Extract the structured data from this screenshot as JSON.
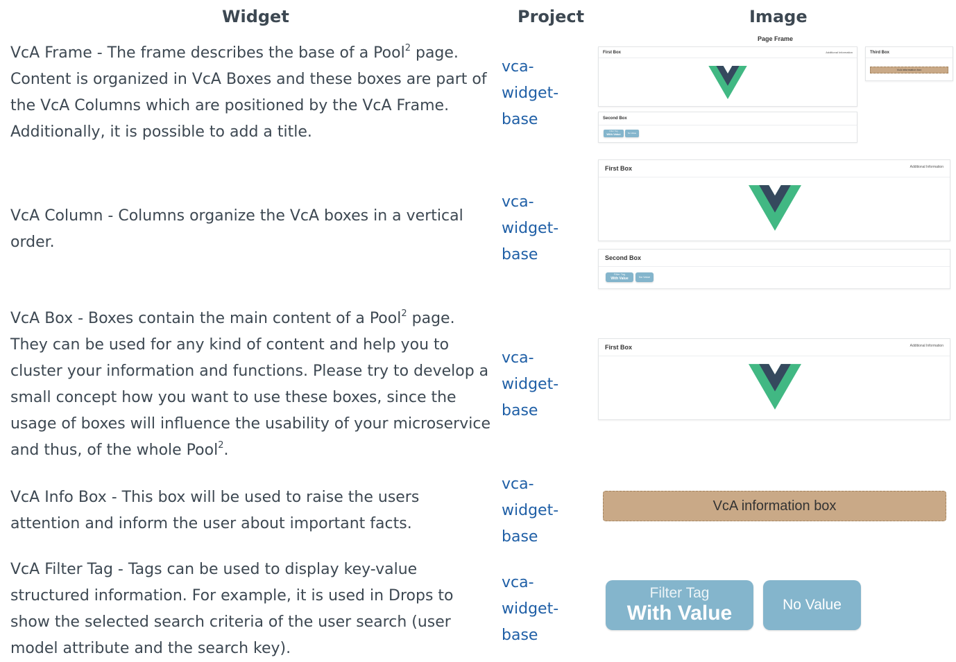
{
  "headers": {
    "widget": "Widget",
    "project": "Project",
    "image": "Image"
  },
  "rows": [
    {
      "widget_text": "VcA Frame - The frame describes the base of a Pool",
      "sup1": "2",
      "widget_text_b": " page. Content is organized in VcA Boxes and these boxes are part of the VcA Columns which are positioned by the VcA Frame. Additionally, it is possible to add a title.",
      "project": "vca-\nwidget-\nbase"
    },
    {
      "widget_text": "VcA Column - Columns organize the VcA boxes in a vertical order.",
      "project": "vca-\nwidget-\nbase"
    },
    {
      "widget_text": "VcA Box - Boxes contain the main content of a Pool",
      "sup1": "2",
      "widget_text_b": " page. They can be used for any kind of content and help you to cluster your information and functions. Please try to develop a small concept how you want to use these boxes, since the usage of boxes will influence the usability of your microservice and thus, of the whole Pool",
      "sup2": "2",
      "widget_text_c": ".",
      "project": "vca-\nwidget-\nbase"
    },
    {
      "widget_text": "VcA Info Box - This box will be used to raise the users attention and inform the user about important facts.",
      "project": "vca-\nwidget-\nbase"
    },
    {
      "widget_text": "VcA Filter Tag - Tags can be used to display key-value structured information. For example, it is used in Drops to show the selected search criteria of the user search (user model attribute and the search key).",
      "project": "vca-\nwidget-\nbase"
    }
  ],
  "images": {
    "frame": {
      "page_title": "Page Frame",
      "first_box": "First Box",
      "additional_info": "Additional Information",
      "third_box": "Third Box",
      "info_box": "VcA information box",
      "second_box": "Second Box",
      "tag_key": "Filter Tag",
      "tag_value": "With Value",
      "tag_novalue": "No Value"
    },
    "column": {
      "first_box": "First Box",
      "additional_info": "Additional Information",
      "second_box": "Second Box",
      "tag_key": "Filter Tag",
      "tag_value": "With Value",
      "tag_novalue": "No Value"
    },
    "box": {
      "first_box": "First Box",
      "additional_info": "Additional Information"
    },
    "info": {
      "label": "VcA information box"
    },
    "filter": {
      "tag_key": "Filter Tag",
      "tag_value": "With Value",
      "tag_novalue": "No Value"
    }
  },
  "colors": {
    "vue_green": "#41b883",
    "vue_dark": "#35495e",
    "tag_blue": "#84b5cc",
    "info_tan": "#c9a987",
    "link": "#1f5fa6"
  }
}
